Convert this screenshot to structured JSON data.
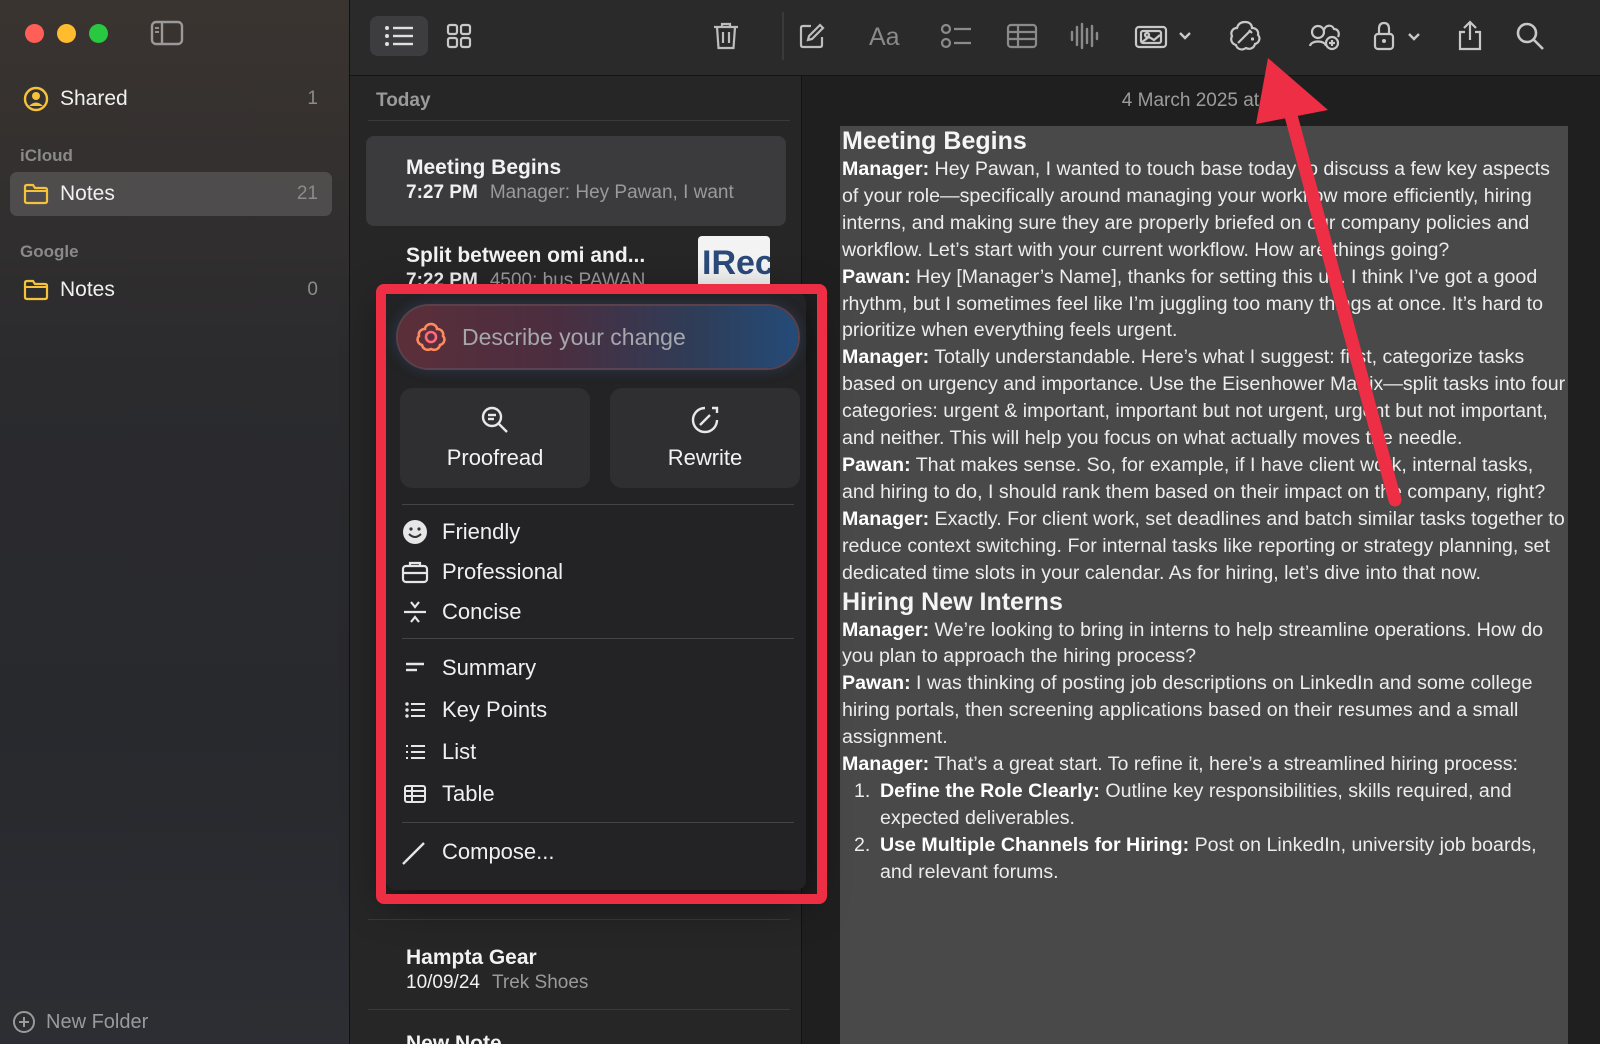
{
  "sidebar": {
    "shared": {
      "label": "Shared",
      "count": "1"
    },
    "sections": [
      {
        "title": "iCloud",
        "folder": "Notes",
        "count": "21"
      },
      {
        "title": "Google",
        "folder": "Notes",
        "count": "0"
      }
    ],
    "new_folder": "New Folder"
  },
  "notelist": {
    "group_label": "Today",
    "notes": [
      {
        "title": "Meeting Begins",
        "time": "7:27 PM",
        "preview": "Manager: Hey Pawan, I want"
      },
      {
        "title": "Split between omi and...",
        "time": "7:22 PM",
        "preview": "4500: bus PAWAN",
        "thumb_text": "IRec"
      },
      {
        "title": "Hampta Gear",
        "time": "10/09/24",
        "preview": "Trek Shoes"
      },
      {
        "title": "New Note",
        "time": "",
        "preview": ""
      }
    ]
  },
  "writing_tools": {
    "placeholder": "Describe your change",
    "proofread": "Proofread",
    "rewrite": "Rewrite",
    "tones": [
      "Friendly",
      "Professional",
      "Concise"
    ],
    "formats": [
      "Summary",
      "Key Points",
      "List",
      "Table"
    ],
    "compose": "Compose..."
  },
  "editor": {
    "date": "4 March 2025 at 7:",
    "heading1": "Meeting Begins",
    "paragraphs1": [
      {
        "speaker": "Manager:",
        "text": " Hey Pawan, I wanted to touch base today to discuss a few key aspects of your role—specifically around managing your workflow more efficiently, hiring interns, and making sure they are properly briefed on our company policies and workflow. Let’s start with your current workflow. How are things going?"
      },
      {
        "speaker": "Pawan:",
        "text": " Hey [Manager’s Name], thanks for setting this up. I think I’ve got a good rhythm, but I sometimes feel like I’m juggling too many things at once. It’s hard to prioritize when everything feels urgent."
      },
      {
        "speaker": "Manager:",
        "text": " Totally understandable. Here’s what I suggest: first, categorize tasks based on urgency and importance. Use the Eisenhower Matrix—split tasks into four categories: urgent & important, important but not urgent, urgent but not important, and neither. This will help you focus on what actually moves the needle."
      },
      {
        "speaker": "Pawan:",
        "text": " That makes sense. So, for example, if I have client work, internal tasks, and hiring to do, I should rank them based on their impact on the company, right?"
      },
      {
        "speaker": "Manager:",
        "text": " Exactly. For client work, set deadlines and batch similar tasks together to reduce context switching. For internal tasks like reporting or strategy planning, set dedicated time slots in your calendar. As for hiring, let’s dive into that now."
      }
    ],
    "heading2": "Hiring New Interns",
    "paragraphs2": [
      {
        "speaker": "Manager:",
        "text": " We’re looking to bring in interns to help streamline operations. How do you plan to approach the hiring process?"
      },
      {
        "speaker": "Pawan:",
        "text": " I was thinking of posting job descriptions on LinkedIn and some college hiring portals, then screening applications based on their resumes and a small assignment."
      },
      {
        "speaker": "Manager:",
        "text": " That’s a great start. To refine it, here’s a streamlined hiring process:"
      }
    ],
    "list": [
      {
        "num": "1.",
        "title": "Define the Role Clearly:",
        "text": " Outline key responsibilities, skills required, and expected deliverables."
      },
      {
        "num": "2.",
        "title": "Use Multiple Channels for Hiring:",
        "text": " Post on LinkedIn, university job boards, and relevant forums."
      }
    ]
  },
  "colors": {
    "highlight_red": "#ee2e45",
    "folder_yellow": "#f5c33b"
  }
}
